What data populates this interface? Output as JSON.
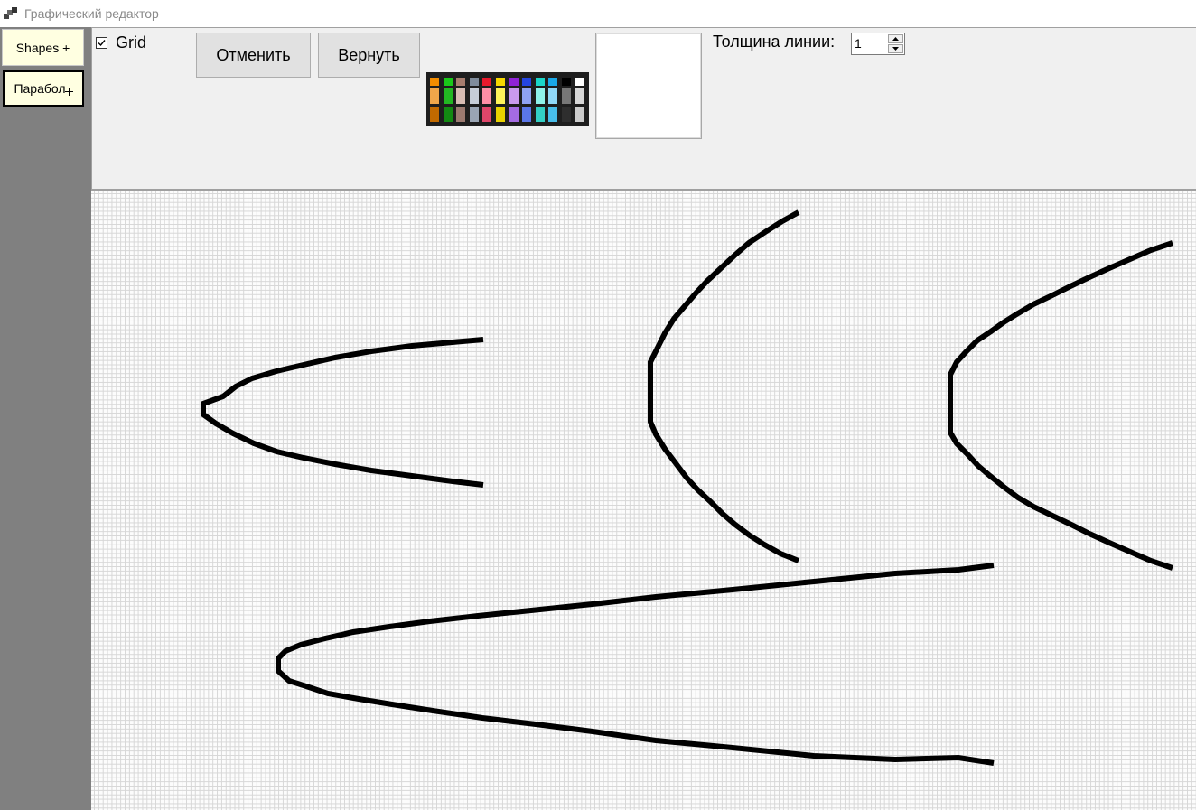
{
  "window": {
    "title": "Графический редактор",
    "icon": "app-window-icon"
  },
  "sidebar": {
    "shapes_label": "Shapes +",
    "parabola_label": "Парабол"
  },
  "toolbar": {
    "grid_label": "Grid",
    "grid_checked": true,
    "undo_label": "Отменить",
    "redo_label": "Вернуть",
    "thickness_label": "Толщина линии:",
    "thickness_value": "1",
    "selected_color": "#ffffff"
  },
  "palette": {
    "columns": [
      [
        "#f28c00",
        "#f0a64a",
        "#c26a00"
      ],
      [
        "#19c819",
        "#22b822",
        "#128a12"
      ],
      [
        "#a87d6e",
        "#d8bdb4",
        "#9c7a70"
      ],
      [
        "#7f8c9c",
        "#c7ced8",
        "#9aa5b4"
      ],
      [
        "#e8192c",
        "#ff8fa6",
        "#e0466a"
      ],
      [
        "#f7d800",
        "#fff35a",
        "#e9d200"
      ],
      [
        "#8f22d6",
        "#c99aee",
        "#a46be2"
      ],
      [
        "#2445e0",
        "#8fa2f2",
        "#5a76e8"
      ],
      [
        "#1ad6c8",
        "#8ff2ea",
        "#33cfc4"
      ],
      [
        "#19a8e8",
        "#8fd8f7",
        "#48bde9"
      ],
      [
        "#000000",
        "#777777",
        "#2e2e2e"
      ],
      [
        "#ffffff",
        "#d8d8d8",
        "#cccccc"
      ]
    ]
  },
  "canvas": {
    "grid": true,
    "stroke_color": "#000000",
    "icon": "drawing-canvas"
  }
}
